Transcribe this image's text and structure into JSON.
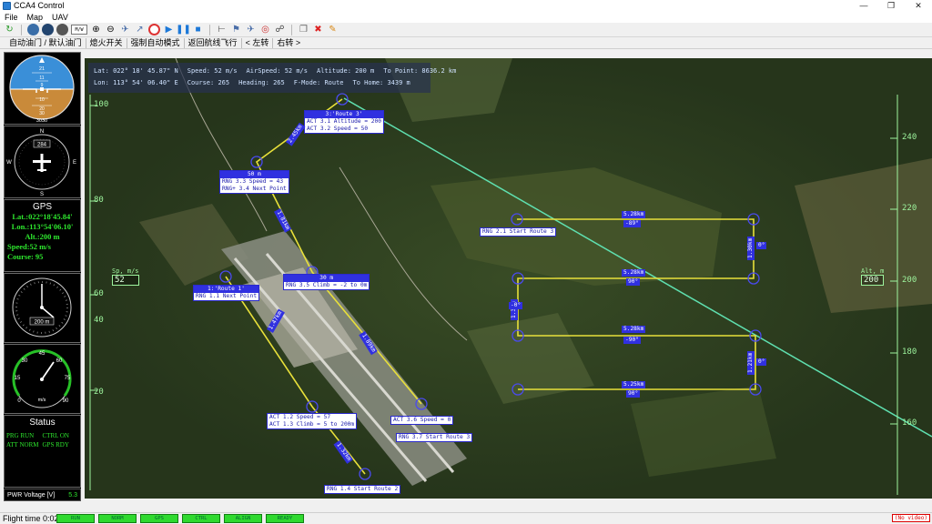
{
  "window": {
    "title": "CCA4 Control",
    "minimize": "—",
    "maximize": "❐",
    "close": "✕"
  },
  "menu": [
    "File",
    "Map",
    "UAV"
  ],
  "toolbar": {
    "mw_label": "M/W",
    "icons": [
      "refresh-icon",
      "globe-icon",
      "globe-dark-icon",
      "sphere-icon",
      "zoom-in-icon",
      "zoom-out-icon",
      "plane-icon",
      "route-icon",
      "record-icon",
      "play-icon",
      "pause-icon",
      "stop-icon",
      "ruler-icon",
      "waypoint-icon",
      "plane-land-icon",
      "rings-icon",
      "antenna-icon",
      "copy-icon",
      "delete-icon",
      "edit-icon"
    ]
  },
  "commands": [
    "自动油门 / 默认油门",
    "熄火开关",
    "强制自动模式",
    "返回航线飞行",
    "< 左转",
    "右转 >"
  ],
  "left_panel": {
    "attitude_ticks": [
      "21",
      "11",
      "9",
      "10",
      "20",
      "30"
    ],
    "attitude_bottom": "3030",
    "heading_value": "284",
    "compass": {
      "n": "N",
      "e": "E",
      "s": "S",
      "w": "W"
    },
    "gps": {
      "title": "GPS",
      "lat": "Lat.:022°18'45.84'",
      "lon": "Lon.:113°54'06.10'",
      "alt": "Alt.:200 m",
      "speed": "Speed:52 m/s",
      "course": "Course: 95"
    },
    "altimeter_value": "200 m",
    "speedo": {
      "ticks": [
        "45",
        "30",
        "60",
        "15",
        "75",
        "0",
        "90"
      ],
      "unit": "m/s"
    },
    "status": {
      "title": "Status",
      "items": [
        "PRG RUN",
        "CTRL ON",
        "ATT NORM",
        "GPS RDY"
      ]
    },
    "pwr_label": "PWR Voltage [V]",
    "pwr_value": "5.3"
  },
  "telemetry": {
    "lat_label": "Lat:",
    "lat": "022° 18' 45.87\" N",
    "speed_label": "Speed:",
    "speed": "52 m/s",
    "airspeed_label": "AirSpeed:",
    "airspeed": "52 m/s",
    "altitude_label": "Altitude:",
    "altitude": "200 m",
    "topoint_label": "To Point:",
    "topoint": "8636.2 km",
    "lon_label": "Lon:",
    "lon": "113° 54' 06.40\" E",
    "course_label": "Course:",
    "course": "265",
    "heading_label": "Heading:",
    "heading": "265",
    "fmode_label": "F-Mode:",
    "fmode": "Route",
    "tohome_label": "To Home:",
    "tohome": "3439 m"
  },
  "waypoints": {
    "r1": {
      "title": "1:'Route 1'",
      "lines": [
        "RNG 1.1 Next Point"
      ]
    },
    "r1_end": {
      "lines": [
        "ACT 1.2 Speed = 57",
        "ACT 1.3 Climb = 5 to 200m"
      ]
    },
    "r1_start2": {
      "lines": [
        "RNG 1.4 Start Route 2"
      ]
    },
    "r3": {
      "title": "3:'Route 3'",
      "lines": [
        "ACT 3.1 Altitude = 200",
        "ACT 3.2 Speed = 50"
      ]
    },
    "r3_b": {
      "title": "50 m",
      "lines": [
        "RNG 3.3 Speed = 43",
        "RNG+ 3.4 Next Point"
      ]
    },
    "r3_c": {
      "title": "30 m",
      "lines": [
        "RNG 3.5 Climb = -2 to 0m"
      ]
    },
    "r3_d": {
      "lines": [
        "ACT 3.6 Speed = 0"
      ]
    },
    "r3_e": {
      "lines": [
        "RNG 3.7 Start Route 3"
      ]
    },
    "r2": {
      "lines": [
        "RNG 2.1 Start Route 3"
      ]
    }
  },
  "distances": {
    "d1": "5.28km",
    "d1b": "-89°",
    "d2": "5.28km",
    "d2b": "90°",
    "d3": "5.28km",
    "d3b": "-90°",
    "d4": "5.25km",
    "d4b": "90°",
    "v1": "1.30km",
    "v1b": "0°",
    "v2": "1.21km",
    "v2b": "0°",
    "v3": "1.3km",
    "v3b": "-0°",
    "s1": "2.45km",
    "s2": "1.81km",
    "s3": "1.47km",
    "s4": "1.89km",
    "s5": "1.32km"
  },
  "scales": {
    "left_label": "Sp, m/s",
    "left_value": "52",
    "right_label": "Alt, m",
    "right_value": "200",
    "left_ticks": [
      "100",
      "80",
      "60",
      "40",
      "20"
    ],
    "right_ticks": [
      "240",
      "220",
      "200",
      "180",
      "160"
    ]
  },
  "bottom": {
    "flight_time": "Flight time 0:02:16",
    "buttons": [
      "RUN",
      "NORM",
      "GPS",
      "CTRL",
      "ALIGN",
      "READY"
    ],
    "no_video": "(No video)"
  },
  "colors": {
    "route": "#e8e03a",
    "home_line": "#5fe0b0",
    "waypoint": "#3a3ad8",
    "status_green": "#2ee82e",
    "scale_green": "#9ef59e"
  }
}
